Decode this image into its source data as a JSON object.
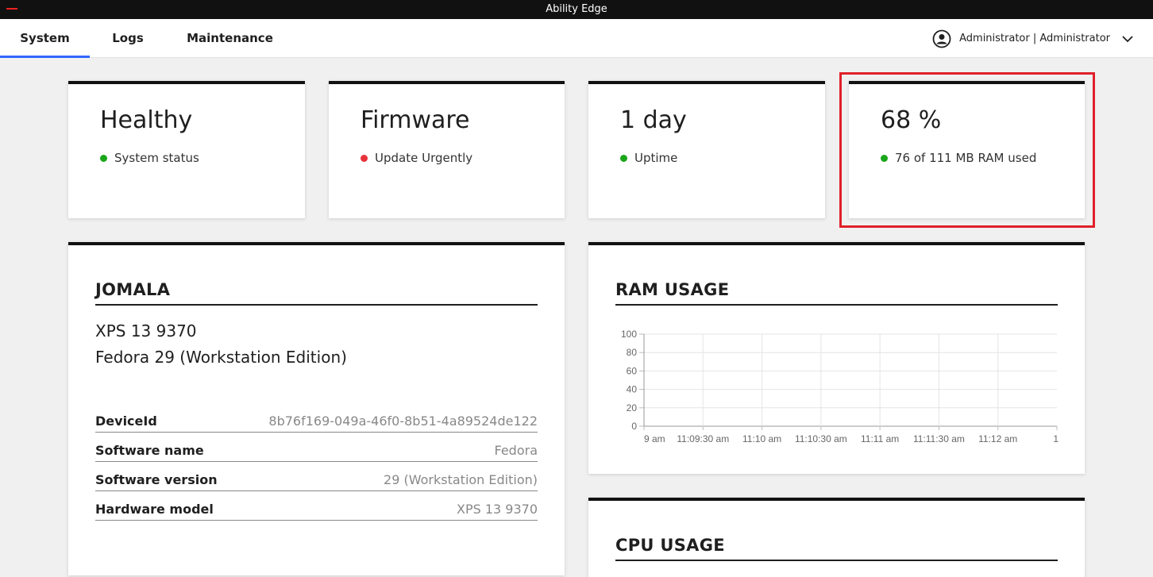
{
  "window": {
    "title": "Ability Edge"
  },
  "nav": {
    "tabs": [
      {
        "label": "System",
        "active": true
      },
      {
        "label": "Logs",
        "active": false
      },
      {
        "label": "Maintenance",
        "active": false
      }
    ],
    "user_label": "Administrator | Administrator"
  },
  "stats": [
    {
      "value": "Healthy",
      "label": "System status",
      "status_color": "#1aa61a"
    },
    {
      "value": "Firmware",
      "label": "Update Urgently",
      "status_color": "#e8323c"
    },
    {
      "value": "1 day",
      "label": "Uptime",
      "status_color": "#1aa61a"
    },
    {
      "value": "68 %",
      "label": "76 of 111 MB RAM used",
      "status_color": "#1aa61a"
    }
  ],
  "device": {
    "title": "JOMALA",
    "model_line": "XPS 13 9370",
    "os_line": "Fedora 29 (Workstation Edition)",
    "properties": [
      {
        "key": "DeviceId",
        "value": "8b76f169-049a-46f0-8b51-4a89524de122"
      },
      {
        "key": "Software name",
        "value": "Fedora"
      },
      {
        "key": "Software version",
        "value": "29 (Workstation Edition)"
      },
      {
        "key": "Hardware model",
        "value": "XPS 13 9370"
      }
    ]
  },
  "ram_usage": {
    "title": "RAM USAGE"
  },
  "cpu_usage": {
    "title": "CPU USAGE"
  },
  "chart_data": {
    "type": "line",
    "title": "RAM USAGE",
    "ylim": [
      0,
      100
    ],
    "y_ticks": [
      "100",
      "80",
      "60",
      "40",
      "20",
      "0"
    ],
    "x_ticks": [
      "9 am",
      "11:09:30 am",
      "11:10 am",
      "11:10:30 am",
      "11:11 am",
      "11:11:30 am",
      "11:12 am",
      "1"
    ],
    "grid": true,
    "series": []
  }
}
